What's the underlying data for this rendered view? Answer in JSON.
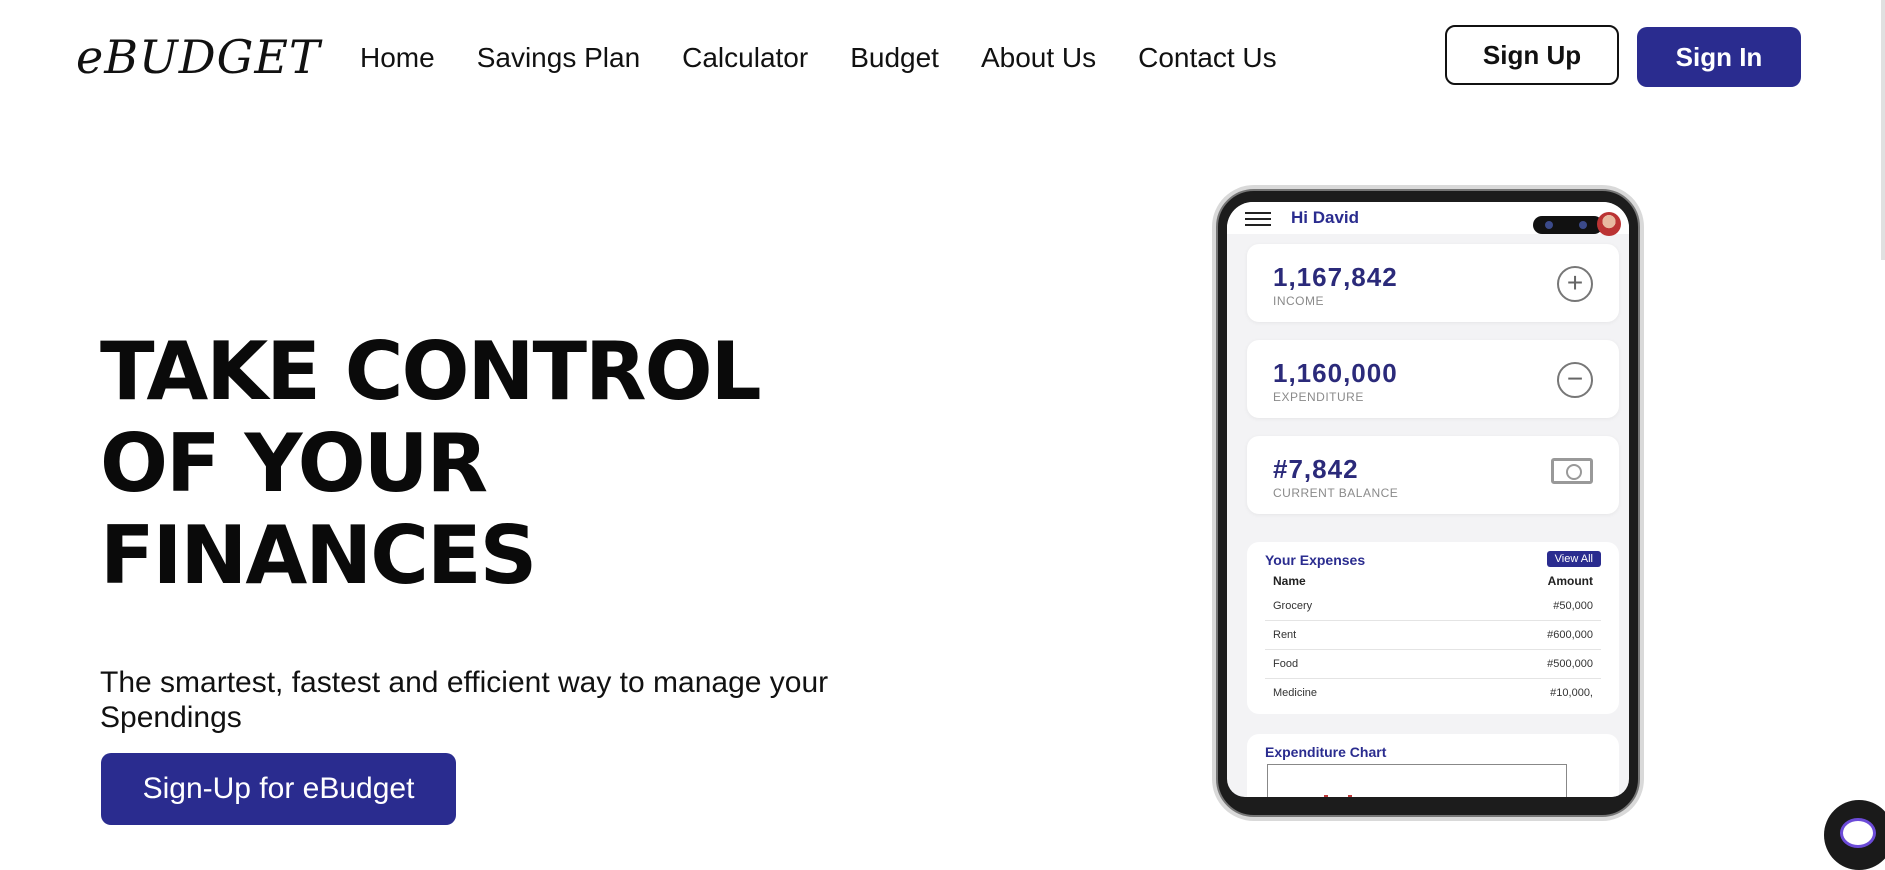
{
  "logo": "eBUDGET",
  "nav": {
    "items": [
      {
        "label": "Home"
      },
      {
        "label": "Savings Plan"
      },
      {
        "label": "Calculator"
      },
      {
        "label": "Budget"
      },
      {
        "label": "About Us"
      },
      {
        "label": "Contact Us"
      }
    ]
  },
  "auth": {
    "signup_label": "Sign Up",
    "signin_label": "Sign In"
  },
  "hero": {
    "title_lines": [
      "TAKE CONTROL",
      "OF YOUR",
      "FINANCES"
    ],
    "subtitle": "The smartest, fastest and efficient way to manage your Spendings",
    "cta_label": "Sign-Up for eBudget"
  },
  "phone": {
    "greeting": "Hi David",
    "cards": [
      {
        "amount": "1,167,842",
        "label": "INCOME",
        "icon": "plus-circle-icon"
      },
      {
        "amount": "1,160,000",
        "label": "EXPENDITURE",
        "icon": "minus-circle-icon"
      },
      {
        "amount": "#7,842",
        "label": "CURRENT BALANCE",
        "icon": "money-icon"
      }
    ],
    "expenses": {
      "title": "Your Expenses",
      "view_all": "View All",
      "col_name": "Name",
      "col_amount": "Amount",
      "rows": [
        {
          "name": "Grocery",
          "amount": "#50,000"
        },
        {
          "name": "Rent",
          "amount": "#600,000"
        },
        {
          "name": "Food",
          "amount": "#500,000"
        },
        {
          "name": "Medicine",
          "amount": "#10,000,"
        }
      ]
    },
    "chart_title": "Expenditure Chart"
  },
  "colors": {
    "brand": "#2a2c8f",
    "amount_text": "#2b2a7a"
  }
}
